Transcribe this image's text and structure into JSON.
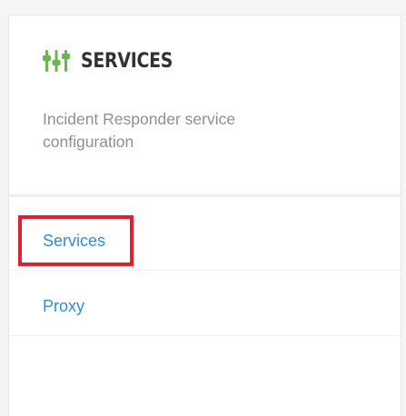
{
  "header": {
    "icon": "sliders-icon",
    "icon_color": "#6ab750",
    "title": "SERVICES",
    "subtitle": "Incident Responder service configuration"
  },
  "nav": {
    "items": [
      {
        "label": "Services",
        "highlighted": true
      },
      {
        "label": "Proxy",
        "highlighted": false
      }
    ]
  },
  "colors": {
    "link": "#2c8ed8",
    "highlight": "#e0202c",
    "title": "#2e3338",
    "subtitle": "#8a9097"
  }
}
